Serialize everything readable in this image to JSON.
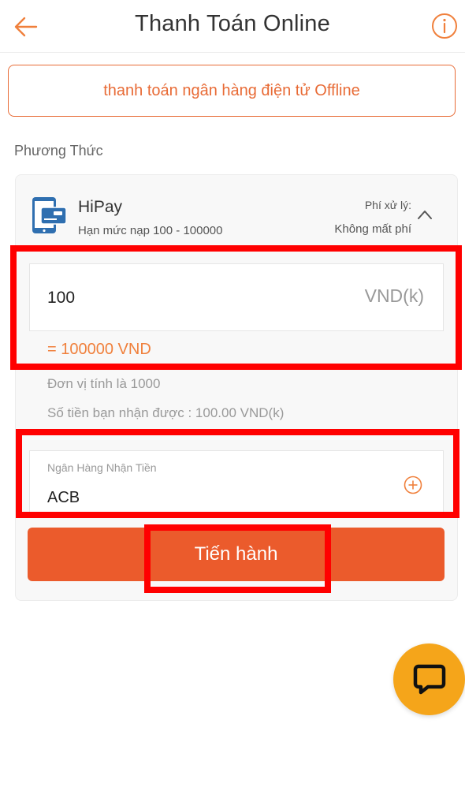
{
  "header": {
    "title": "Thanh Toán Online"
  },
  "offline_button": {
    "label": "thanh toán ngân hàng điện tử Offline"
  },
  "section": {
    "label": "Phương Thức"
  },
  "method": {
    "name": "HiPay",
    "limit": "Hạn mức nạp 100 - 100000",
    "fee_label": "Phí xử lý:",
    "fee_value": "Không mất phí"
  },
  "amount": {
    "value": "100",
    "unit": "VND(k)",
    "converted": "= 100000 VND",
    "unit_note": "Đơn vị tính là 1000",
    "receive_note": "Số tiền bạn nhận được : 100.00 VND(k)"
  },
  "bank": {
    "label": "Ngân Hàng Nhận Tiền",
    "value": "ACB"
  },
  "submit": {
    "label": "Tiến hành"
  },
  "colors": {
    "accent": "#eb5b2c",
    "highlight": "#ff0000",
    "chat_button": "#f5a51a"
  },
  "icons": {
    "back": "arrow-left",
    "info": "info-circle",
    "method": "mobile-card",
    "expand": "chevron-up",
    "add_bank": "plus-circle",
    "chat": "chat-bubble"
  }
}
